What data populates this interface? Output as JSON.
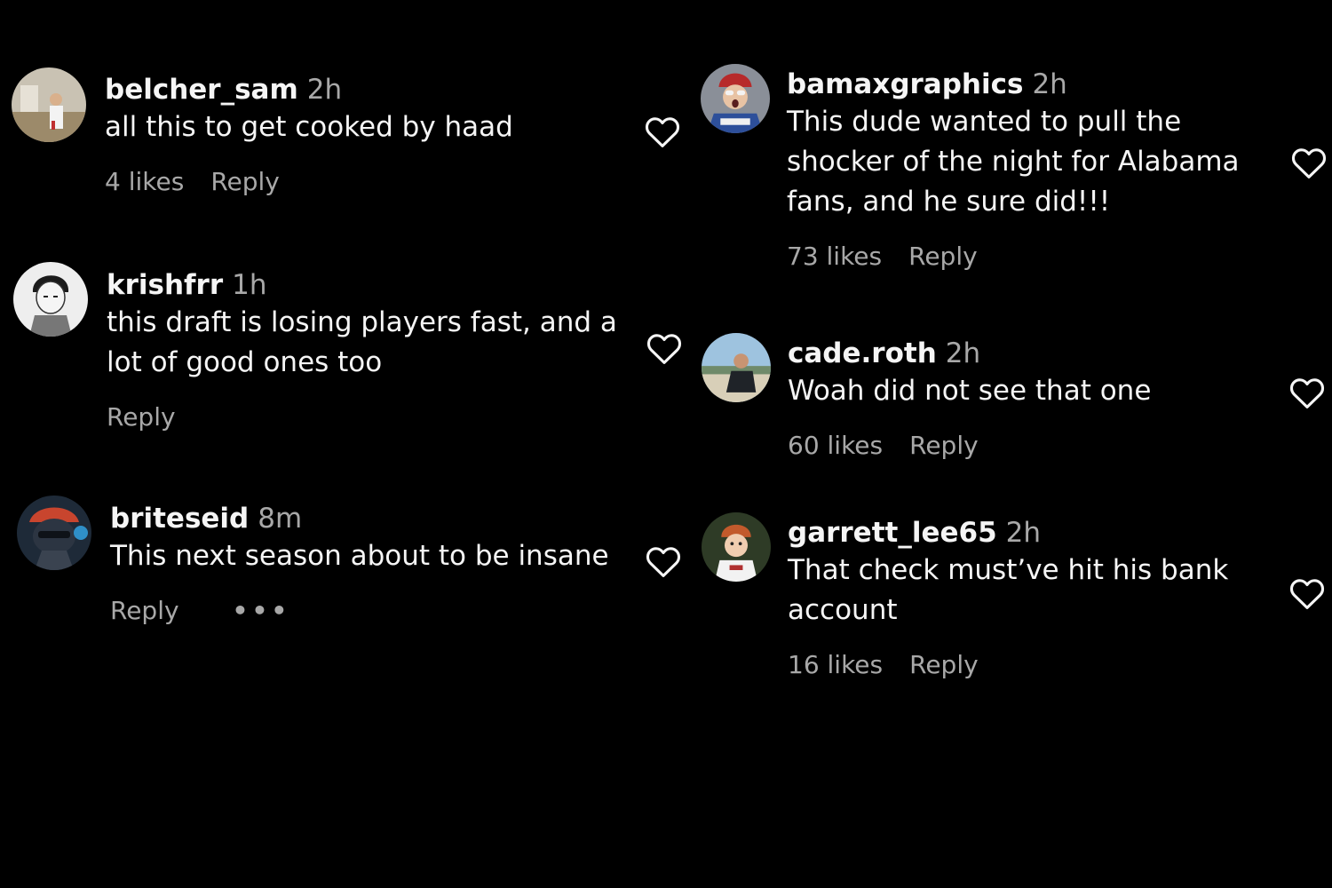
{
  "left": [
    {
      "username": "belcher_sam",
      "time": "2h",
      "text": "all this to get cooked by haad",
      "likes": "4 likes",
      "reply": "Reply"
    },
    {
      "username": "krishfrr",
      "time": "1h",
      "text": "this draft is losing players fast, and a lot of good ones too",
      "likes": "",
      "reply": "Reply"
    },
    {
      "username": "briteseid",
      "time": "8m",
      "text": "This next season about to be insane",
      "likes": "",
      "reply": "Reply",
      "more": "•••"
    }
  ],
  "right": [
    {
      "username": "bamaxgraphics",
      "time": "2h",
      "text": "This dude wanted to pull the shocker of the night for Alabama fans, and he sure did!!!",
      "likes": "73 likes",
      "reply": "Reply"
    },
    {
      "username": "cade.roth",
      "time": "2h",
      "text": "Woah did not see that one",
      "likes": "60 likes",
      "reply": "Reply"
    },
    {
      "username": "garrett_lee65",
      "time": "2h",
      "text": "That check must’ve hit his bank account",
      "likes": "16 likes",
      "reply": "Reply"
    }
  ],
  "icons": {
    "like": "heart-outline-icon",
    "more": "more-horizontal-icon"
  },
  "colors": {
    "background": "#000000",
    "text": "#f5f5f5",
    "secondary": "#a8a8a8"
  }
}
